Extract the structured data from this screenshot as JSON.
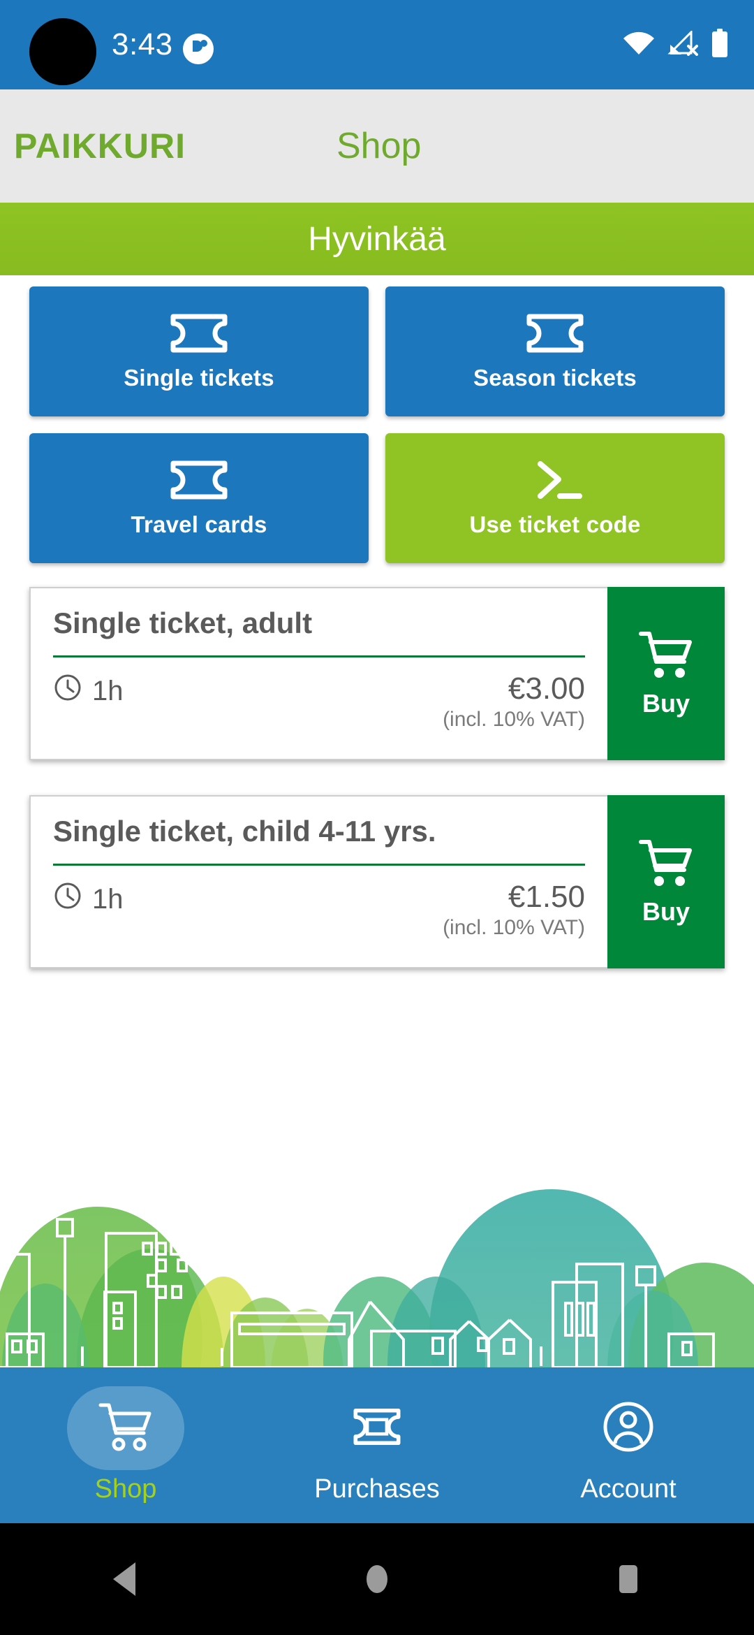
{
  "status_bar": {
    "time": "3:43",
    "notification_icon": "app-notification-icon",
    "wifi_icon": "wifi-icon",
    "cellular_icon": "cellular-no-sim-icon",
    "battery_icon": "battery-full-icon",
    "background_color": "#1d77bc"
  },
  "app_header": {
    "brand": "PAIKKURI",
    "title": "Shop",
    "brand_color": "#6faa2e",
    "background_color": "#e8e8e8"
  },
  "location_bar": {
    "city": "Hyvinkää",
    "background_color": "#8fc424"
  },
  "tiles": [
    {
      "label": "Single tickets",
      "icon": "ticket-icon",
      "style": "blue"
    },
    {
      "label": "Season tickets",
      "icon": "ticket-icon",
      "style": "blue"
    },
    {
      "label": "Travel cards",
      "icon": "ticket-icon",
      "style": "blue"
    },
    {
      "label": "Use ticket code",
      "icon": "terminal-prompt-icon",
      "style": "green"
    }
  ],
  "ticket_cards": [
    {
      "title": "Single ticket, adult",
      "duration_icon": "clock-icon",
      "duration": "1h",
      "price": "€3.00",
      "vat_note": "(incl. 10% VAT)",
      "buy_label": "Buy",
      "buy_icon": "shopping-cart-icon"
    },
    {
      "title": "Single ticket, child 4-11 yrs.",
      "duration_icon": "clock-icon",
      "duration": "1h",
      "price": "€1.50",
      "vat_note": "(incl. 10% VAT)",
      "buy_label": "Buy",
      "buy_icon": "shopping-cart-icon"
    }
  ],
  "bottom_nav": {
    "items": [
      {
        "label": "Shop",
        "icon": "shopping-cart-icon",
        "active": true
      },
      {
        "label": "Purchases",
        "icon": "ticket-icon",
        "active": false
      },
      {
        "label": "Account",
        "icon": "person-circle-icon",
        "active": false
      }
    ],
    "background_color": "#2980bd",
    "active_color": "#a4d11b"
  },
  "android_nav": {
    "back_icon": "back-triangle-icon",
    "home_icon": "home-circle-icon",
    "recents_icon": "recents-square-icon"
  },
  "colors": {
    "brand_blue": "#1d77bc",
    "brand_green": "#8fc424",
    "buy_green": "#00873a",
    "card_rule_green": "#0b7a36"
  }
}
